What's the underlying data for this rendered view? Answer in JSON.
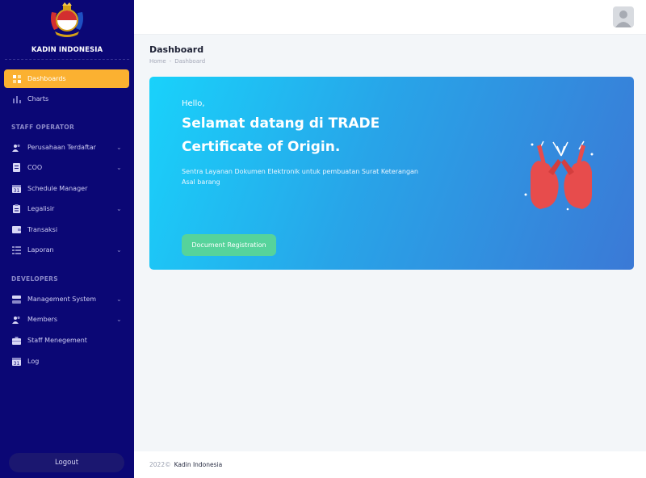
{
  "brand": {
    "name": "KADIN INDONESIA"
  },
  "sidebar": {
    "main_items": [
      {
        "label": "Dashboards",
        "icon": "dashboard-icon",
        "active": true
      },
      {
        "label": "Charts",
        "icon": "chart-icon"
      }
    ],
    "sections": [
      {
        "title": "STAFF OPERATOR",
        "items": [
          {
            "label": "Perusahaan Terdaftar",
            "icon": "users-icon",
            "expandable": true
          },
          {
            "label": "COO",
            "icon": "document-icon",
            "expandable": true
          },
          {
            "label": "Schedule Manager",
            "icon": "calendar-icon"
          },
          {
            "label": "Legalisir",
            "icon": "clipboard-icon",
            "expandable": true
          },
          {
            "label": "Transaksi",
            "icon": "wallet-icon"
          },
          {
            "label": "Laporan",
            "icon": "list-icon",
            "expandable": true
          }
        ]
      },
      {
        "title": "DEVELOPERS",
        "items": [
          {
            "label": "Management System",
            "icon": "server-icon",
            "expandable": true
          },
          {
            "label": "Members",
            "icon": "users-icon",
            "expandable": true
          },
          {
            "label": "Staff Menegement",
            "icon": "briefcase-icon"
          },
          {
            "label": "Log",
            "icon": "calendar-icon"
          }
        ]
      }
    ],
    "logout_label": "Logout"
  },
  "page": {
    "title": "Dashboard",
    "breadcrumb": [
      "Home",
      "Dashboard"
    ],
    "breadcrumb_sep": "-"
  },
  "hero": {
    "greeting": "Hello,",
    "headline_line1": "Selamat datang di TRADE",
    "headline_line2": "Certificate of Origin.",
    "description": "Sentra Layanan Dokumen Elektronik untuk pembuatan Surat Keterangan Asal barang",
    "cta_label": "Document Registration",
    "illustration": "hands-icon"
  },
  "footer": {
    "year": "2022©",
    "org": "Kadin Indonesia"
  },
  "colors": {
    "sidebar_bg": "#0b0775",
    "active_item": "#fbb131",
    "hero_gradient_start": "#19d2fb",
    "hero_gradient_end": "#3b79d6",
    "cta": "#56d39b"
  }
}
